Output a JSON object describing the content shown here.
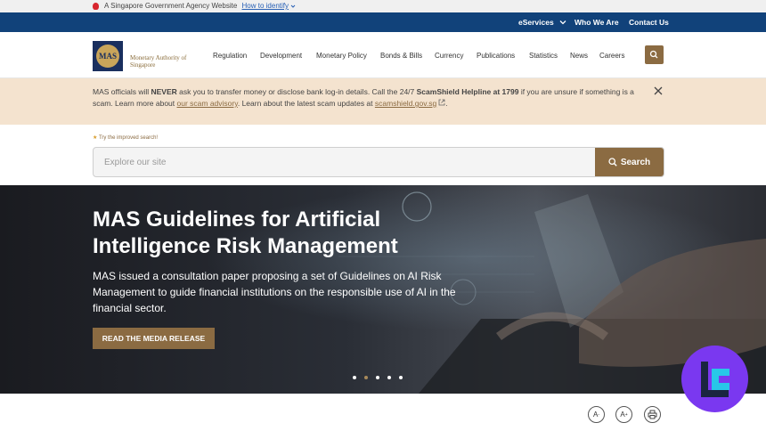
{
  "gov_bar": {
    "text": "A Singapore Government Agency Website",
    "link": "How to identify"
  },
  "top_nav": {
    "eservices": "eServices",
    "who_we_are": "Who We Are",
    "contact_us": "Contact Us"
  },
  "logo": {
    "initials": "MAS",
    "name": "Monetary Authority of Singapore"
  },
  "main_nav": [
    "Regulation",
    "Development",
    "Monetary Policy",
    "Bonds & Bills",
    "Currency",
    "Publications",
    "Statistics",
    "News",
    "Careers"
  ],
  "alert": {
    "p1": "MAS officials will ",
    "never": "NEVER",
    "p2": " ask you to transfer money or disclose bank log-in details. Call the 24/7 ",
    "helpline": "ScamShield Helpline at 1799",
    "p3": " if you are unsure if something is a scam. Learn more about ",
    "advisory": "our scam advisory",
    "p4": ". Learn about the latest scam updates at ",
    "site": "scamshield.gov.sg",
    "p5": "."
  },
  "search": {
    "hint": "Try the improved search!",
    "placeholder": "Explore our site",
    "button": "Search"
  },
  "hero": {
    "title": "MAS Guidelines for Artificial Intelligence Risk Management",
    "description": "MAS issued a consultation paper proposing a set of Guidelines on AI Risk Management to guide financial institutions on the responsible use of AI in the financial sector.",
    "cta": "READ THE MEDIA RELEASE",
    "slides_total": 5,
    "active_slide": 2
  },
  "tools": {
    "decrease": "A",
    "increase": "A"
  },
  "colors": {
    "navy": "#11427a",
    "brand_gold": "#8b6b42",
    "alert_bg": "#f4e3cf",
    "badge": "#7a38f0"
  }
}
